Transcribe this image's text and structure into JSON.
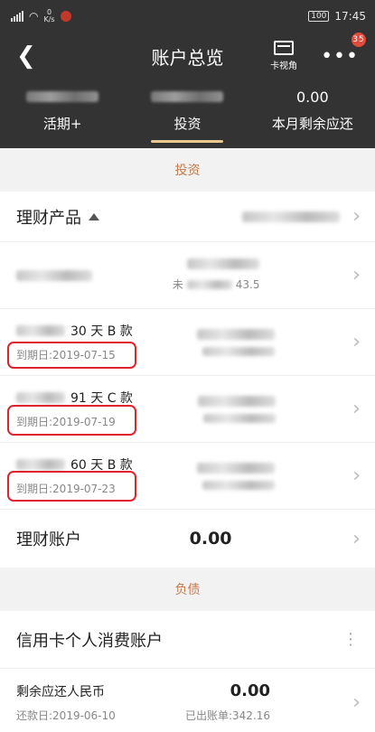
{
  "status": {
    "net_top": "0",
    "net_unit": "K/s",
    "battery": "100",
    "time": "17:45"
  },
  "header": {
    "title": "账户总览",
    "card_view": "卡视角",
    "badge": "35"
  },
  "tabs": [
    {
      "label": "活期+",
      "value": ""
    },
    {
      "label": "投资",
      "value": ""
    },
    {
      "label": "本月剩余应还",
      "value": "0.00"
    }
  ],
  "section_invest": "投资",
  "wealth_products": {
    "label": "理财产品",
    "items": [
      {
        "name": "",
        "date": ""
      },
      {
        "name": "30 天 B 款",
        "date": "到期日:2019-07-15"
      },
      {
        "name": "91 天 C 款",
        "date": "到期日:2019-07-19"
      },
      {
        "name": "60 天 B 款",
        "date": "到期日:2019-07-23"
      }
    ],
    "partial_text": "未",
    "partial_amount": "43.5"
  },
  "wealth_account": {
    "label": "理财账户",
    "amount": "0.00"
  },
  "section_debt": "负债",
  "credit": {
    "title": "信用卡个人消费账户",
    "row_label": "剩余应还人民币",
    "due_date": "还款日:2019-06-10",
    "amount": "0.00",
    "billed": "已出账单:342.16"
  },
  "colors": {
    "accent": "#c6794a",
    "highlight": "#e0232c",
    "dark": "#333333",
    "tab_indicator": "#e8c98f"
  }
}
